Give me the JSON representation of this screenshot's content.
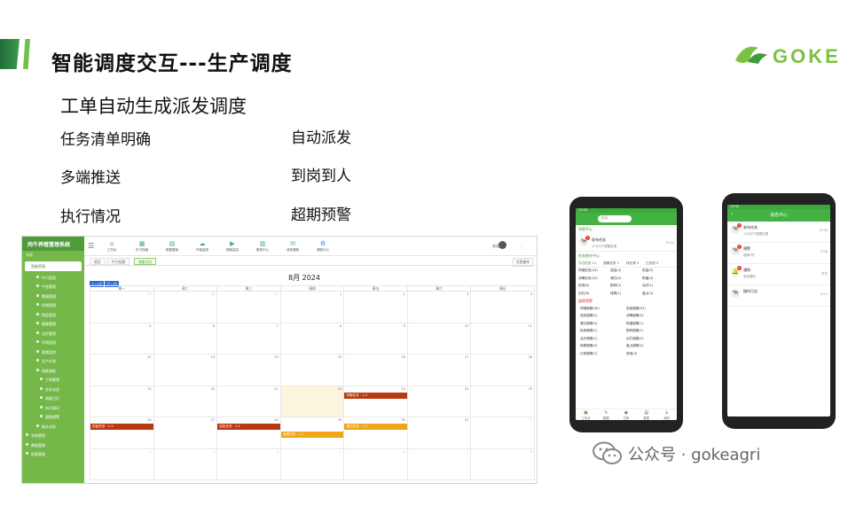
{
  "slide": {
    "title": "智能调度交互---生产调度",
    "subtitle": "工单自动生成派发调度",
    "bullets_left": [
      "任务清单明确",
      "多端推送",
      "执行情况"
    ],
    "bullets_right": [
      "自动派发",
      "到岗到人",
      "超期预警"
    ],
    "logo_text": "GOKE",
    "watermark": "公众号 · gokeagri"
  },
  "desktop": {
    "brand": "肉牛养殖管理系统",
    "sidebar_section": "导航",
    "sidebar_items": [
      {
        "label": "智能养殖",
        "level": 0,
        "active": true
      },
      {
        "label": "牛只档案",
        "level": 1
      },
      {
        "label": "牛舍管理",
        "level": 1
      },
      {
        "label": "繁殖管理",
        "level": 1
      },
      {
        "label": "饲喂管理",
        "level": 1
      },
      {
        "label": "防疫管理",
        "level": 1
      },
      {
        "label": "健康管理",
        "level": 1
      },
      {
        "label": "出栏管理",
        "level": 1
      },
      {
        "label": "环境监测",
        "level": 1
      },
      {
        "label": "视频监控",
        "level": 1
      },
      {
        "label": "生产计划",
        "level": 1
      },
      {
        "label": "智能调度",
        "level": 1
      },
      {
        "label": "工单管理",
        "level": 2
      },
      {
        "label": "任务派发",
        "level": 2
      },
      {
        "label": "调度日历",
        "level": 2
      },
      {
        "label": "执行情况",
        "level": 2
      },
      {
        "label": "超期预警",
        "level": 2
      },
      {
        "label": "统计分析",
        "level": 1
      },
      {
        "label": "系统管理",
        "level": 0
      },
      {
        "label": "数据管理",
        "level": 0
      },
      {
        "label": "权限管理",
        "level": 0
      }
    ],
    "toolbar": [
      "工作台",
      "牛只档案",
      "数据看板",
      "环境监测",
      "视频监控",
      "报表中心",
      "消息通知",
      "调度中心"
    ],
    "top_right": "欢迎您",
    "tabs": [
      "首页",
      "牛只档案",
      "调度日历"
    ],
    "tab_ops": "页签操作",
    "calendar": {
      "nav_prev": "上一月",
      "nav_next": "下一月",
      "title": "8月 2024",
      "weekdays": [
        "周一",
        "周二",
        "周三",
        "周四",
        "周五",
        "周六",
        "周日"
      ],
      "weeks": [
        [
          "29",
          "30",
          "31",
          "1",
          "2",
          "3",
          "4"
        ],
        [
          "5",
          "6",
          "7",
          "8",
          "9",
          "10",
          "11"
        ],
        [
          "12",
          "13",
          "14",
          "15",
          "16",
          "17",
          "18"
        ],
        [
          "19",
          "20",
          "21",
          "22",
          "23",
          "24",
          "25"
        ],
        [
          "26",
          "27",
          "28",
          "29",
          "30",
          "31",
          "1"
        ],
        [
          "2",
          "3",
          "4",
          "5",
          "6",
          "7",
          "8"
        ]
      ],
      "events": [
        {
          "week": 3,
          "day": 4,
          "slot": 0,
          "label": "饲喂任务 · 1-2",
          "color": "red"
        },
        {
          "week": 4,
          "day": 0,
          "slot": 0,
          "label": "防疫任务 · 1-2",
          "color": "red"
        },
        {
          "week": 4,
          "day": 2,
          "slot": 0,
          "label": "巡检任务 · 1-2",
          "color": "red"
        },
        {
          "week": 4,
          "day": 4,
          "slot": 0,
          "label": "清扫任务 · 1-2",
          "color": "orange"
        },
        {
          "week": 4,
          "day": 3,
          "slot": 1,
          "label": "消毒任务 · 1-2",
          "color": "orange"
        }
      ]
    }
  },
  "phone1": {
    "status": "13:30",
    "search": "搜索",
    "section_msg": "消息中心",
    "msg_title": "发布任务",
    "msg_sub": "12头牛只需要处理",
    "msg_time": "10:30",
    "section_task": "任务统计中心",
    "task_tabs": [
      "今日任务 12",
      "超期任务 2",
      "待处理 3",
      "已完成 9"
    ],
    "task_grid": [
      "饲喂任务(24)",
      "巡检(4)",
      "防疫(9)",
      "消毒任务(20)",
      "清扫(5)",
      "称重(3)",
      "检测(6)",
      "配种(2)",
      "治疗(1)",
      "出栏(8)",
      "转群(1)",
      "盘点(3)"
    ],
    "section_alert": "超期预警",
    "alert_grid": [
      "饲喂超期(30)",
      "防疫超期(22)",
      "巡检超期(1)",
      "消毒超期(2)",
      "清扫超期(4)",
      "称重超期(1)",
      "检测超期(1)",
      "配种超期(1)",
      "治疗超期(1)",
      "出栏超期(2)",
      "转群超期(4)",
      "盘点超期(2)",
      "记录超期(7)",
      "其他(3)"
    ],
    "bottom": [
      "工作台",
      "数据",
      "扫码",
      "报表",
      "我的"
    ]
  },
  "phone2": {
    "status": "13:30",
    "title": "消息中心",
    "messages": [
      {
        "title": "发布任务",
        "sub": "12头牛只需要处理",
        "time": "10:30",
        "badge": "1"
      },
      {
        "title": "预警",
        "sub": "超期2项",
        "time": "9:28",
        "badge": "1"
      },
      {
        "title": "通知",
        "sub": "系统通知",
        "time": "昨天",
        "badge": "2"
      },
      {
        "title": "操作日志",
        "sub": "",
        "time": "8:12",
        "badge": ""
      }
    ]
  }
}
